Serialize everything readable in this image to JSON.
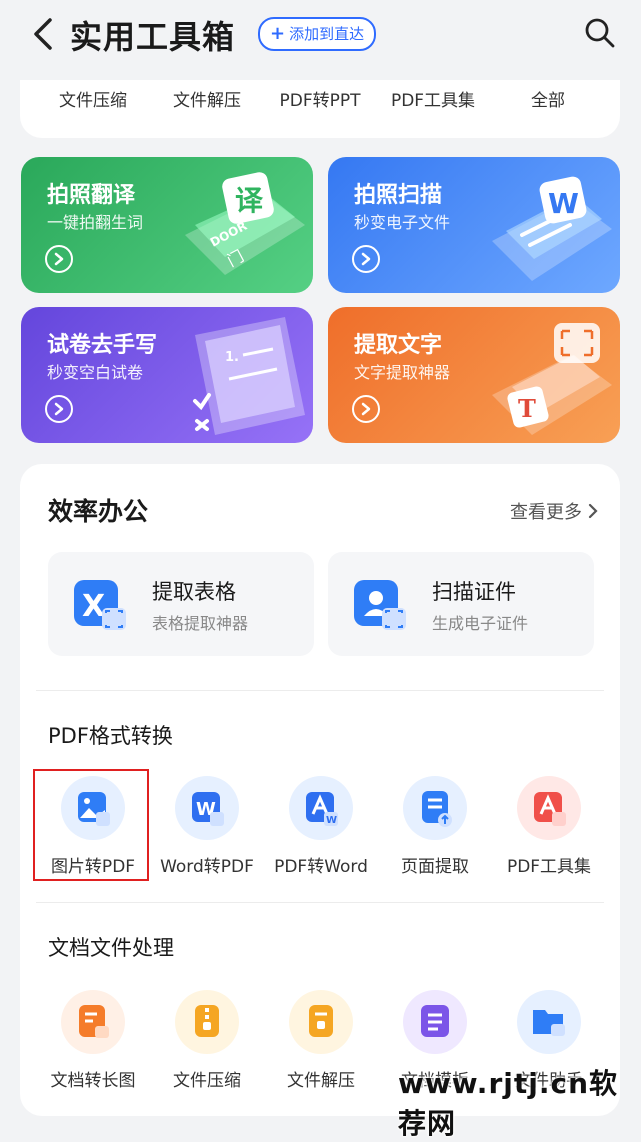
{
  "header": {
    "title": "实用工具箱",
    "add_button_label": "添加到直达"
  },
  "quick_items": [
    "文件压缩",
    "文件解压",
    "PDF转PPT",
    "PDF工具集",
    "全部"
  ],
  "features": [
    {
      "title": "拍照翻译",
      "subtitle": "一键拍翻生词",
      "art_text": "译",
      "art_sub": "DOOR",
      "art_sub2": "门",
      "color_start": "#2fb45f",
      "color_end": "#4fce7d"
    },
    {
      "title": "拍照扫描",
      "subtitle": "秒变电子文件",
      "art_text": "W",
      "color_start": "#3d7ef5",
      "color_end": "#62a0ff"
    },
    {
      "title": "试卷去手写",
      "subtitle": "秒变空白试卷",
      "art_text": "1.",
      "color_start": "#6a4ce0",
      "color_end": "#8f6af5"
    },
    {
      "title": "提取文字",
      "subtitle": "文字提取神器",
      "art_text": "T",
      "color_start": "#f0762f",
      "color_end": "#f7984f"
    }
  ],
  "office": {
    "title": "效率办公",
    "more_label": "查看更多",
    "tools": [
      {
        "name": "提取表格",
        "desc": "表格提取神器"
      },
      {
        "name": "扫描证件",
        "desc": "生成电子证件"
      }
    ],
    "pdf_section_title": "PDF格式转换",
    "pdf_items": [
      {
        "label": "图片转PDF",
        "icon": "image-to-pdf-icon",
        "color": "#2f7df6"
      },
      {
        "label": "Word转PDF",
        "icon": "word-to-pdf-icon",
        "color": "#2f6ff0"
      },
      {
        "label": "PDF转Word",
        "icon": "pdf-to-word-icon",
        "color": "#2f6ff0"
      },
      {
        "label": "页面提取",
        "icon": "page-extract-icon",
        "color": "#2f7df6"
      },
      {
        "label": "PDF工具集",
        "icon": "pdf-tools-icon",
        "color": "#f0504a"
      }
    ],
    "doc_section_title": "文档文件处理",
    "doc_items": [
      {
        "label": "文档转长图",
        "icon": "doc-to-image-icon",
        "color": "#f57c2a"
      },
      {
        "label": "文件压缩",
        "icon": "file-compress-icon",
        "color": "#f5a623"
      },
      {
        "label": "文件解压",
        "icon": "file-extract-icon",
        "color": "#f5a623"
      },
      {
        "label": "文档模板",
        "icon": "doc-template-icon",
        "color": "#7b55e8"
      },
      {
        "label": "文件助手",
        "icon": "file-helper-icon",
        "color": "#2f7df6"
      }
    ]
  },
  "watermark": "www.rjtj.cn软荐网"
}
